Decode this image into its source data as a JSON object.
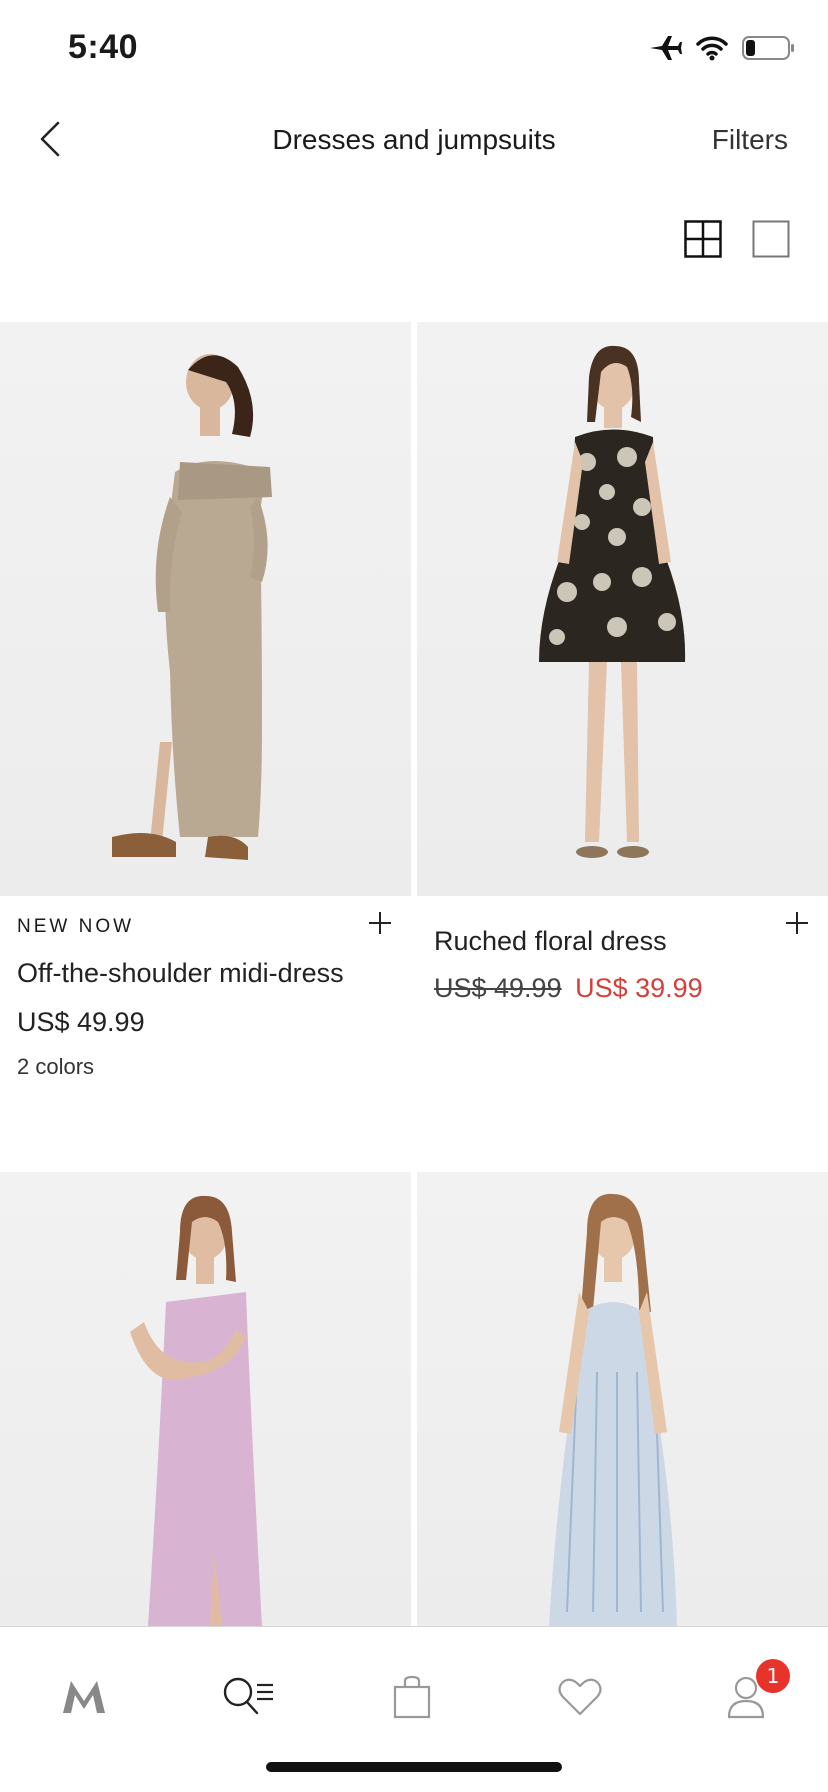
{
  "status_bar": {
    "time": "5:40"
  },
  "header": {
    "title": "Dresses and jumpsuits",
    "filters_label": "Filters"
  },
  "products": [
    {
      "badge": "NEW NOW",
      "name": "Off-the-shoulder midi-dress",
      "price": "US$ 49.99",
      "colors": "2 colors",
      "dress_color": "#b9a993"
    },
    {
      "name": "Ruched floral dress",
      "old_price": "US$ 49.99",
      "sale_price": "US$ 39.99",
      "dress_color": "#2b2620"
    },
    {
      "dress_color": "#d8b4d2"
    },
    {
      "dress_color": "#cdd8e6"
    }
  ],
  "bottom_nav": {
    "items": [
      "home-logo",
      "search-menu",
      "bag",
      "wishlist",
      "account"
    ],
    "account_badge": "1"
  },
  "colors": {
    "accent": "#e8332d",
    "sale": "#d43f3a",
    "text": "#1a1a1a"
  }
}
